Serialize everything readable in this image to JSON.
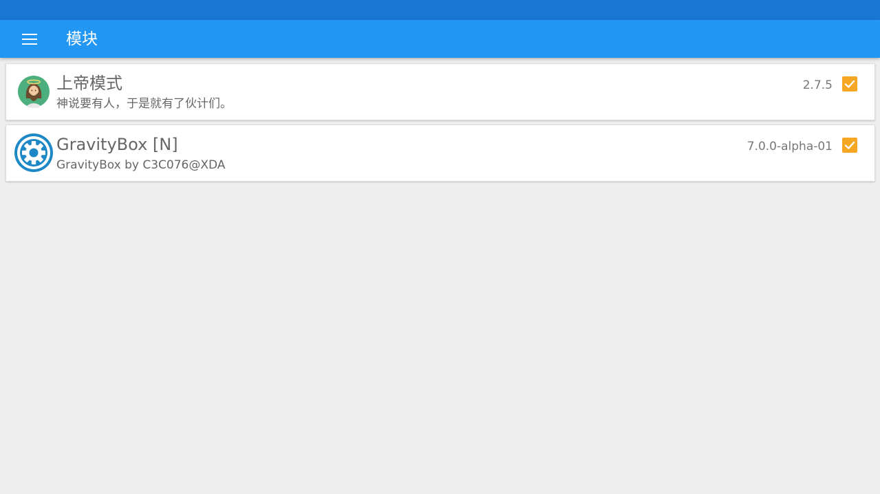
{
  "app_bar": {
    "menu_icon": "hamburger-menu-icon",
    "title": "模块"
  },
  "modules": [
    {
      "icon": "jesus-avatar-icon",
      "name": "上帝模式",
      "description": "神说要有人，于是就有了伙计们。",
      "version": "2.7.5",
      "enabled": true
    },
    {
      "icon": "gear-icon",
      "name": "GravityBox [N]",
      "description": "GravityBox by C3C076@XDA",
      "version": "7.0.0-alpha-01",
      "enabled": true
    }
  ],
  "colors": {
    "status_bar": "#1976d2",
    "app_bar": "#2196f3",
    "background": "#eeeeee",
    "checkbox": "#f5a623"
  }
}
